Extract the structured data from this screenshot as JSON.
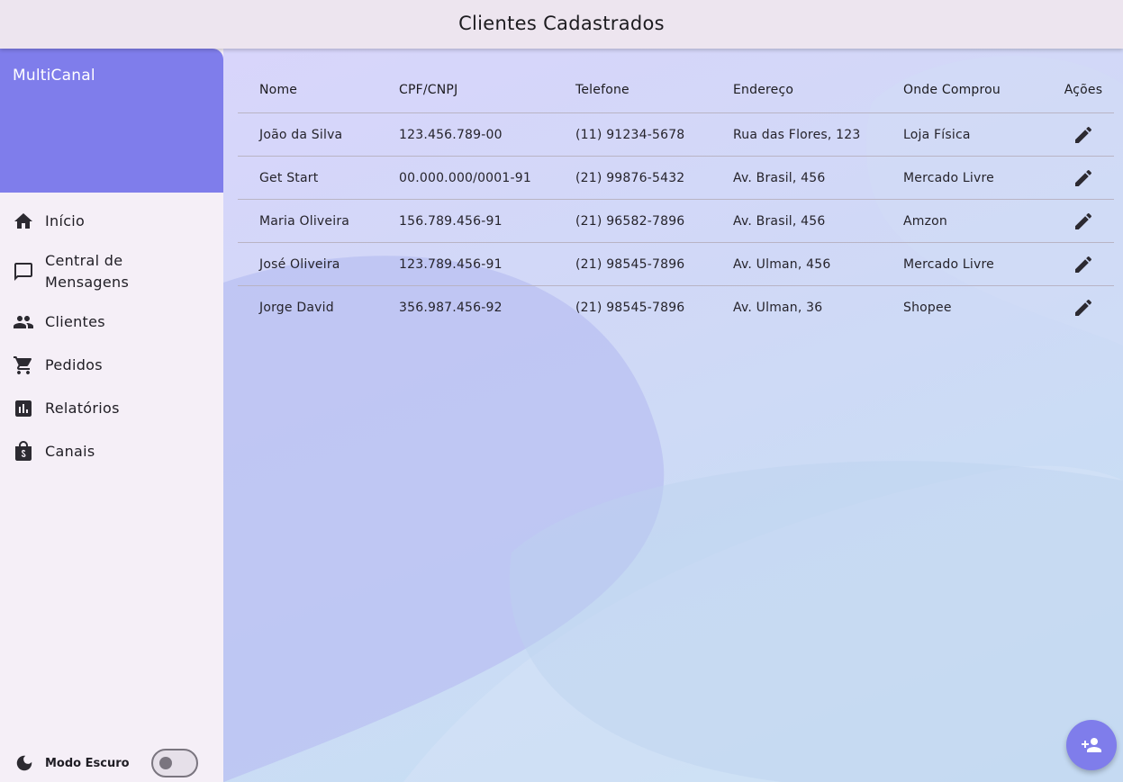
{
  "appbar": {
    "title": "Clientes Cadastrados"
  },
  "drawer": {
    "title": "MultiCanal",
    "items": [
      {
        "label": "Início",
        "icon": "home-icon"
      },
      {
        "label": "Central de Mensagens",
        "icon": "chat-bubble-icon"
      },
      {
        "label": "Clientes",
        "icon": "people-icon"
      },
      {
        "label": "Pedidos",
        "icon": "cart-icon"
      },
      {
        "label": "Relatórios",
        "icon": "bar-chart-icon"
      },
      {
        "label": "Canais",
        "icon": "shopping-bag-icon"
      }
    ],
    "dark_mode": {
      "label": "Modo Escuro",
      "enabled": false
    }
  },
  "table": {
    "headers": [
      "Nome",
      "CPF/CNPJ",
      "Telefone",
      "Endereço",
      "Onde Comprou",
      "Ações"
    ],
    "rows": [
      [
        "João da Silva",
        "123.456.789-00",
        "(11) 91234-5678",
        "Rua das Flores, 123",
        "Loja Física"
      ],
      [
        "Get Start",
        "00.000.000/0001-91",
        "(21) 99876-5432",
        "Av. Brasil, 456",
        "Mercado Livre"
      ],
      [
        "Maria Oliveira",
        "156.789.456-91",
        "(21) 96582-7896",
        "Av. Brasil, 456",
        "Amzon"
      ],
      [
        "José Oliveira",
        "123.789.456-91",
        "(21) 98545-7896",
        "Av. Ulman, 456",
        "Mercado Livre"
      ],
      [
        "Jorge David",
        "356.987.456-92",
        "(21) 98545-7896",
        "Av. Ulman, 36",
        "Shopee"
      ]
    ],
    "action_icon": "edit-icon"
  },
  "fab": {
    "icon": "person-add-icon"
  },
  "colors": {
    "accent": "#7f7deb",
    "appbar": "#ede5ef",
    "drawer": "#f5eff7"
  }
}
